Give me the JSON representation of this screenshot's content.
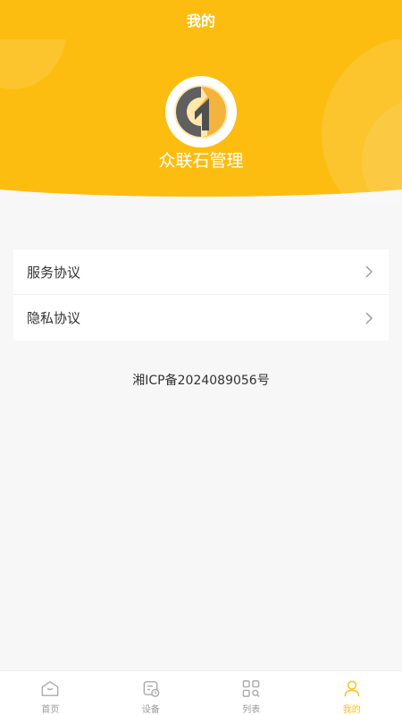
{
  "header": {
    "title": "我的",
    "brand_name": "众联石管理",
    "accent": "#fcbd10"
  },
  "menu": {
    "items": [
      {
        "label": "服务协议",
        "icon": "chevron-right-icon"
      },
      {
        "label": "隐私协议",
        "icon": "chevron-right-icon"
      }
    ]
  },
  "footer": {
    "icp": "湘ICP备2024089056号"
  },
  "tabbar": {
    "tabs": [
      {
        "label": "首页",
        "icon": "home-icon",
        "active": false
      },
      {
        "label": "设备",
        "icon": "device-icon",
        "active": false
      },
      {
        "label": "列表",
        "icon": "list-icon",
        "active": false
      },
      {
        "label": "我的",
        "icon": "user-icon",
        "active": true
      }
    ]
  }
}
